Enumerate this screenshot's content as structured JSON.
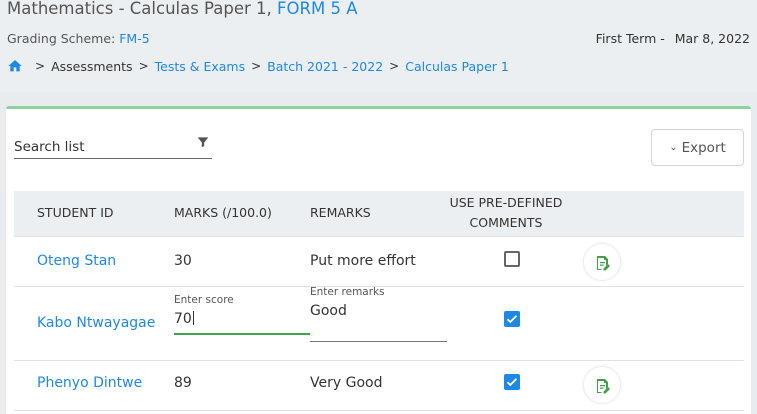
{
  "header": {
    "title": "Mathematics - Calculas Paper 1,",
    "form": "FORM 5 A",
    "grading_label": "Grading Scheme:",
    "grading_value": "FM-5",
    "term": "First Term -",
    "date": "Mar 8, 2022"
  },
  "breadcrumb": {
    "items": [
      "Assessments",
      "Tests & Exams",
      "Batch 2021 - 2022",
      "Calculas Paper 1"
    ]
  },
  "toolbar": {
    "search_label": "Search list",
    "export_label": "Export"
  },
  "table": {
    "headers": {
      "student_id": "STUDENT ID",
      "marks": "MARKS (/100.0)",
      "remarks": "REMARKS",
      "predefined_line1": "USE PRE-DEFINED",
      "predefined_line2": "COMMENTS"
    },
    "rows": [
      {
        "student": "Oteng Stan",
        "marks": "30",
        "remarks": "Put more effort",
        "predefined": false
      },
      {
        "student": "Kabo Ntwayagae",
        "marks": "70",
        "remarks": "Good",
        "predefined": true,
        "score_label": "Enter score",
        "remarks_label": "Enter remarks"
      },
      {
        "student": "Phenyo Dintwe",
        "marks": "89",
        "remarks": "Very Good",
        "predefined": true
      }
    ]
  },
  "colors": {
    "accent": "#1e88e5",
    "green": "#43a047",
    "card_border": "#8fd19e"
  },
  "icons": {
    "home": "home-icon",
    "filter": "filter-icon",
    "chevron": "chevron-down-icon",
    "edit": "edit-note-icon",
    "check": "check-icon"
  }
}
